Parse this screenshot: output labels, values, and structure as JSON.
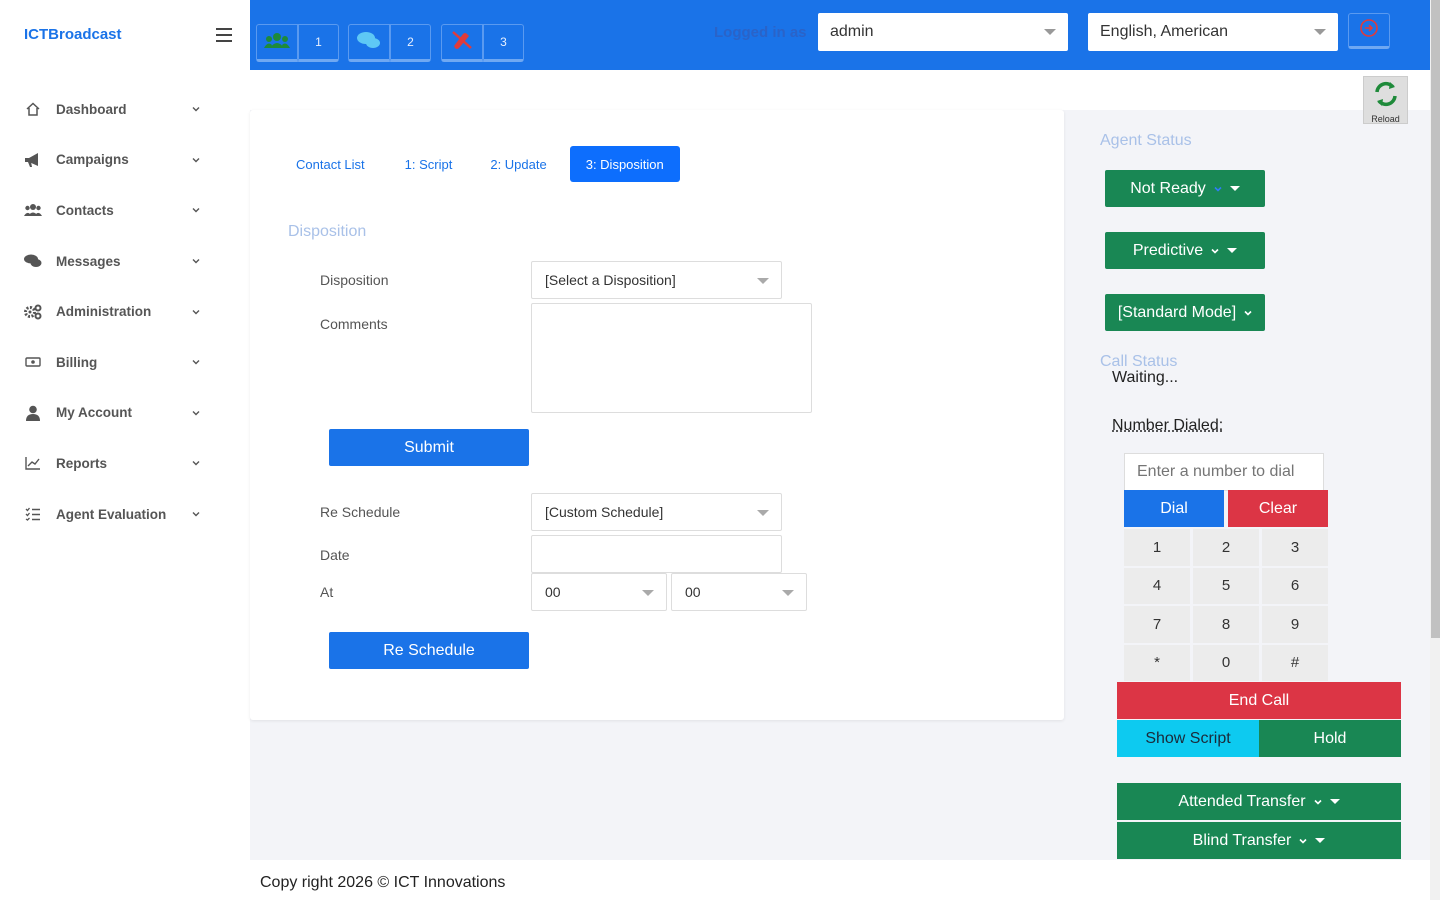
{
  "brand": "ICTBroadcast",
  "sidebar": {
    "items": [
      {
        "label": "Dashboard",
        "icon": "home-icon"
      },
      {
        "label": "Campaigns",
        "icon": "bullhorn-icon"
      },
      {
        "label": "Contacts",
        "icon": "users-icon"
      },
      {
        "label": "Messages",
        "icon": "comments-icon"
      },
      {
        "label": "Administration",
        "icon": "gears-icon"
      },
      {
        "label": "Billing",
        "icon": "money-icon"
      },
      {
        "label": "My Account",
        "icon": "user-icon"
      },
      {
        "label": "Reports",
        "icon": "chart-line-icon"
      },
      {
        "label": "Agent Evaluation",
        "icon": "checklist-icon"
      }
    ]
  },
  "topbar": {
    "counter_1": "1",
    "counter_2": "2",
    "counter_3": "3",
    "faint_label": "Logged in as",
    "user_select": "admin",
    "language_select": "English, American"
  },
  "reload_label": "Reload",
  "tabs": [
    "Contact List",
    "1: Script",
    "2: Update",
    "3: Disposition"
  ],
  "form": {
    "section_title": "Disposition",
    "disposition_label": "Disposition",
    "disposition_value": "[Select a Disposition]",
    "comments_label": "Comments",
    "submit_label": "Submit",
    "reschedule_label": "Re Schedule",
    "reschedule_value": "[Custom Schedule]",
    "date_label": "Date",
    "at_label": "At",
    "hour_value": "00",
    "minute_value": "00",
    "reschedule_button": "Re Schedule"
  },
  "right_panel": {
    "agent_status_title": "Agent Status",
    "not_ready": "Not Ready",
    "predictive": "Predictive",
    "standard_mode": "[Standard Mode]",
    "call_status_title": "Call Status",
    "call_status_value": "Waiting...",
    "number_dialed_label": "Number Dialed:",
    "dial_placeholder": "Enter a number to dial",
    "dial": "Dial",
    "clear": "Clear",
    "keys": [
      "1",
      "2",
      "3",
      "4",
      "5",
      "6",
      "7",
      "8",
      "9",
      "*",
      "0",
      "#"
    ],
    "end_call": "End Call",
    "show_script": "Show Script",
    "hold": "Hold",
    "attended_transfer": "Attended Transfer",
    "blind_transfer": "Blind Transfer"
  },
  "footer": "Copy right 2026 © ICT Innovations",
  "colors": {
    "primary": "#1a73e8",
    "active_tab": "#0d6efd",
    "success": "#198754",
    "danger": "#dc3545",
    "info": "#0dcaf0",
    "muted_title": "#a9c1e8"
  }
}
